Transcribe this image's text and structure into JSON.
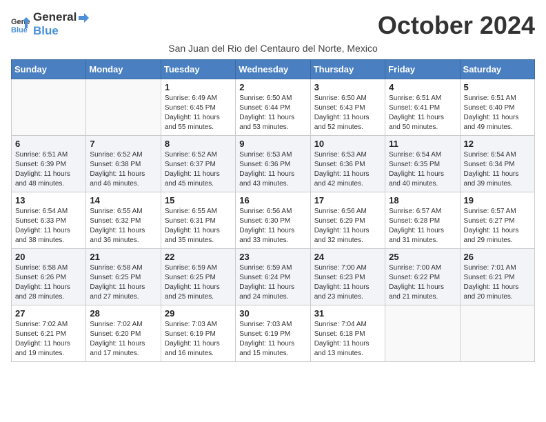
{
  "header": {
    "logo_general": "General",
    "logo_blue": "Blue",
    "month_title": "October 2024",
    "subtitle": "San Juan del Rio del Centauro del Norte, Mexico"
  },
  "weekdays": [
    "Sunday",
    "Monday",
    "Tuesday",
    "Wednesday",
    "Thursday",
    "Friday",
    "Saturday"
  ],
  "weeks": [
    [
      {
        "day": "",
        "sunrise": "",
        "sunset": "",
        "daylight": ""
      },
      {
        "day": "",
        "sunrise": "",
        "sunset": "",
        "daylight": ""
      },
      {
        "day": "1",
        "sunrise": "Sunrise: 6:49 AM",
        "sunset": "Sunset: 6:45 PM",
        "daylight": "Daylight: 11 hours and 55 minutes."
      },
      {
        "day": "2",
        "sunrise": "Sunrise: 6:50 AM",
        "sunset": "Sunset: 6:44 PM",
        "daylight": "Daylight: 11 hours and 53 minutes."
      },
      {
        "day": "3",
        "sunrise": "Sunrise: 6:50 AM",
        "sunset": "Sunset: 6:43 PM",
        "daylight": "Daylight: 11 hours and 52 minutes."
      },
      {
        "day": "4",
        "sunrise": "Sunrise: 6:51 AM",
        "sunset": "Sunset: 6:41 PM",
        "daylight": "Daylight: 11 hours and 50 minutes."
      },
      {
        "day": "5",
        "sunrise": "Sunrise: 6:51 AM",
        "sunset": "Sunset: 6:40 PM",
        "daylight": "Daylight: 11 hours and 49 minutes."
      }
    ],
    [
      {
        "day": "6",
        "sunrise": "Sunrise: 6:51 AM",
        "sunset": "Sunset: 6:39 PM",
        "daylight": "Daylight: 11 hours and 48 minutes."
      },
      {
        "day": "7",
        "sunrise": "Sunrise: 6:52 AM",
        "sunset": "Sunset: 6:38 PM",
        "daylight": "Daylight: 11 hours and 46 minutes."
      },
      {
        "day": "8",
        "sunrise": "Sunrise: 6:52 AM",
        "sunset": "Sunset: 6:37 PM",
        "daylight": "Daylight: 11 hours and 45 minutes."
      },
      {
        "day": "9",
        "sunrise": "Sunrise: 6:53 AM",
        "sunset": "Sunset: 6:36 PM",
        "daylight": "Daylight: 11 hours and 43 minutes."
      },
      {
        "day": "10",
        "sunrise": "Sunrise: 6:53 AM",
        "sunset": "Sunset: 6:36 PM",
        "daylight": "Daylight: 11 hours and 42 minutes."
      },
      {
        "day": "11",
        "sunrise": "Sunrise: 6:54 AM",
        "sunset": "Sunset: 6:35 PM",
        "daylight": "Daylight: 11 hours and 40 minutes."
      },
      {
        "day": "12",
        "sunrise": "Sunrise: 6:54 AM",
        "sunset": "Sunset: 6:34 PM",
        "daylight": "Daylight: 11 hours and 39 minutes."
      }
    ],
    [
      {
        "day": "13",
        "sunrise": "Sunrise: 6:54 AM",
        "sunset": "Sunset: 6:33 PM",
        "daylight": "Daylight: 11 hours and 38 minutes."
      },
      {
        "day": "14",
        "sunrise": "Sunrise: 6:55 AM",
        "sunset": "Sunset: 6:32 PM",
        "daylight": "Daylight: 11 hours and 36 minutes."
      },
      {
        "day": "15",
        "sunrise": "Sunrise: 6:55 AM",
        "sunset": "Sunset: 6:31 PM",
        "daylight": "Daylight: 11 hours and 35 minutes."
      },
      {
        "day": "16",
        "sunrise": "Sunrise: 6:56 AM",
        "sunset": "Sunset: 6:30 PM",
        "daylight": "Daylight: 11 hours and 33 minutes."
      },
      {
        "day": "17",
        "sunrise": "Sunrise: 6:56 AM",
        "sunset": "Sunset: 6:29 PM",
        "daylight": "Daylight: 11 hours and 32 minutes."
      },
      {
        "day": "18",
        "sunrise": "Sunrise: 6:57 AM",
        "sunset": "Sunset: 6:28 PM",
        "daylight": "Daylight: 11 hours and 31 minutes."
      },
      {
        "day": "19",
        "sunrise": "Sunrise: 6:57 AM",
        "sunset": "Sunset: 6:27 PM",
        "daylight": "Daylight: 11 hours and 29 minutes."
      }
    ],
    [
      {
        "day": "20",
        "sunrise": "Sunrise: 6:58 AM",
        "sunset": "Sunset: 6:26 PM",
        "daylight": "Daylight: 11 hours and 28 minutes."
      },
      {
        "day": "21",
        "sunrise": "Sunrise: 6:58 AM",
        "sunset": "Sunset: 6:25 PM",
        "daylight": "Daylight: 11 hours and 27 minutes."
      },
      {
        "day": "22",
        "sunrise": "Sunrise: 6:59 AM",
        "sunset": "Sunset: 6:25 PM",
        "daylight": "Daylight: 11 hours and 25 minutes."
      },
      {
        "day": "23",
        "sunrise": "Sunrise: 6:59 AM",
        "sunset": "Sunset: 6:24 PM",
        "daylight": "Daylight: 11 hours and 24 minutes."
      },
      {
        "day": "24",
        "sunrise": "Sunrise: 7:00 AM",
        "sunset": "Sunset: 6:23 PM",
        "daylight": "Daylight: 11 hours and 23 minutes."
      },
      {
        "day": "25",
        "sunrise": "Sunrise: 7:00 AM",
        "sunset": "Sunset: 6:22 PM",
        "daylight": "Daylight: 11 hours and 21 minutes."
      },
      {
        "day": "26",
        "sunrise": "Sunrise: 7:01 AM",
        "sunset": "Sunset: 6:21 PM",
        "daylight": "Daylight: 11 hours and 20 minutes."
      }
    ],
    [
      {
        "day": "27",
        "sunrise": "Sunrise: 7:02 AM",
        "sunset": "Sunset: 6:21 PM",
        "daylight": "Daylight: 11 hours and 19 minutes."
      },
      {
        "day": "28",
        "sunrise": "Sunrise: 7:02 AM",
        "sunset": "Sunset: 6:20 PM",
        "daylight": "Daylight: 11 hours and 17 minutes."
      },
      {
        "day": "29",
        "sunrise": "Sunrise: 7:03 AM",
        "sunset": "Sunset: 6:19 PM",
        "daylight": "Daylight: 11 hours and 16 minutes."
      },
      {
        "day": "30",
        "sunrise": "Sunrise: 7:03 AM",
        "sunset": "Sunset: 6:19 PM",
        "daylight": "Daylight: 11 hours and 15 minutes."
      },
      {
        "day": "31",
        "sunrise": "Sunrise: 7:04 AM",
        "sunset": "Sunset: 6:18 PM",
        "daylight": "Daylight: 11 hours and 13 minutes."
      },
      {
        "day": "",
        "sunrise": "",
        "sunset": "",
        "daylight": ""
      },
      {
        "day": "",
        "sunrise": "",
        "sunset": "",
        "daylight": ""
      }
    ]
  ]
}
